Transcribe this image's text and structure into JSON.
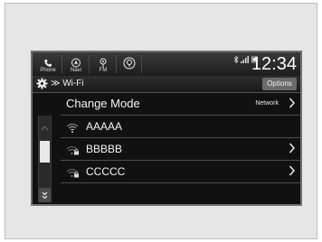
{
  "shortcuts": [
    {
      "label": "Phone",
      "icon": "phone-icon"
    },
    {
      "label": "Navi",
      "icon": "navi-icon"
    },
    {
      "label": "FM",
      "icon": "radio-icon"
    },
    {
      "label": "",
      "icon": "media-icon"
    }
  ],
  "status": {
    "icons": [
      "bluetooth-icon",
      "signal-icon",
      "battery-icon"
    ]
  },
  "clock": "12:34",
  "breadcrumb": {
    "icon": "gear-icon",
    "text": "≫ Wi-Fi"
  },
  "options_label": "Options",
  "list": {
    "header": {
      "title": "Change Mode",
      "value": "Network"
    },
    "networks": [
      {
        "name": "AAAAA",
        "icon": "wifi-icon",
        "locked": false
      },
      {
        "name": "BBBBB",
        "icon": "wifi-locked-icon",
        "locked": true
      },
      {
        "name": "CCCCC",
        "icon": "wifi-locked-icon",
        "locked": true
      }
    ]
  },
  "colors": {
    "screen_bg": "#111111",
    "text": "#f4f4f4",
    "button_bg": "#6a6a6a"
  }
}
